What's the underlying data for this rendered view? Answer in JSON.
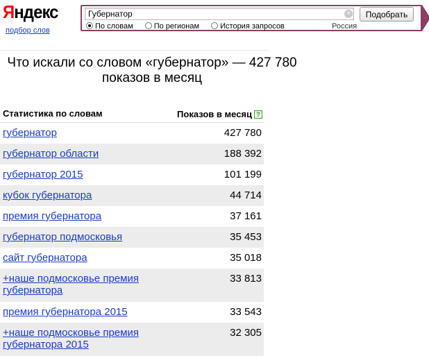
{
  "logo": {
    "text_first": "Я",
    "text_rest": "ндекс",
    "sublink": "подбор слов"
  },
  "search": {
    "value": "Губернатор",
    "clear_icon": "×",
    "submit_label": "Подобрать",
    "modes": [
      {
        "label": "По словам",
        "selected": true
      },
      {
        "label": "По регионам",
        "selected": false
      },
      {
        "label": "История запросов",
        "selected": false
      }
    ],
    "region": "Россия"
  },
  "heading": "Что искали со словом «губернатор» — 427 780 показов в месяц",
  "table": {
    "col_keyword": "Статистика по словам",
    "col_shows": "Показов в месяц",
    "help_icon": "?",
    "rows": [
      {
        "keyword": "губернатор",
        "shows": "427 780"
      },
      {
        "keyword": "губернатор области",
        "shows": "188 392"
      },
      {
        "keyword": "губернатор 2015",
        "shows": "101 199"
      },
      {
        "keyword": "кубок губернатора",
        "shows": "44 714"
      },
      {
        "keyword": "премия губернатора",
        "shows": "37 161"
      },
      {
        "keyword": "губернатор подмосковья",
        "shows": "35 453"
      },
      {
        "keyword": "сайт губернатора",
        "shows": "35 018"
      },
      {
        "keyword": "+наше подмосковье премия губернатора",
        "shows": "33 813"
      },
      {
        "keyword": "премия губернатора 2015",
        "shows": "33 543"
      },
      {
        "keyword": "+наше подмосковье премия губернатора 2015",
        "shows": "32 305"
      }
    ]
  }
}
